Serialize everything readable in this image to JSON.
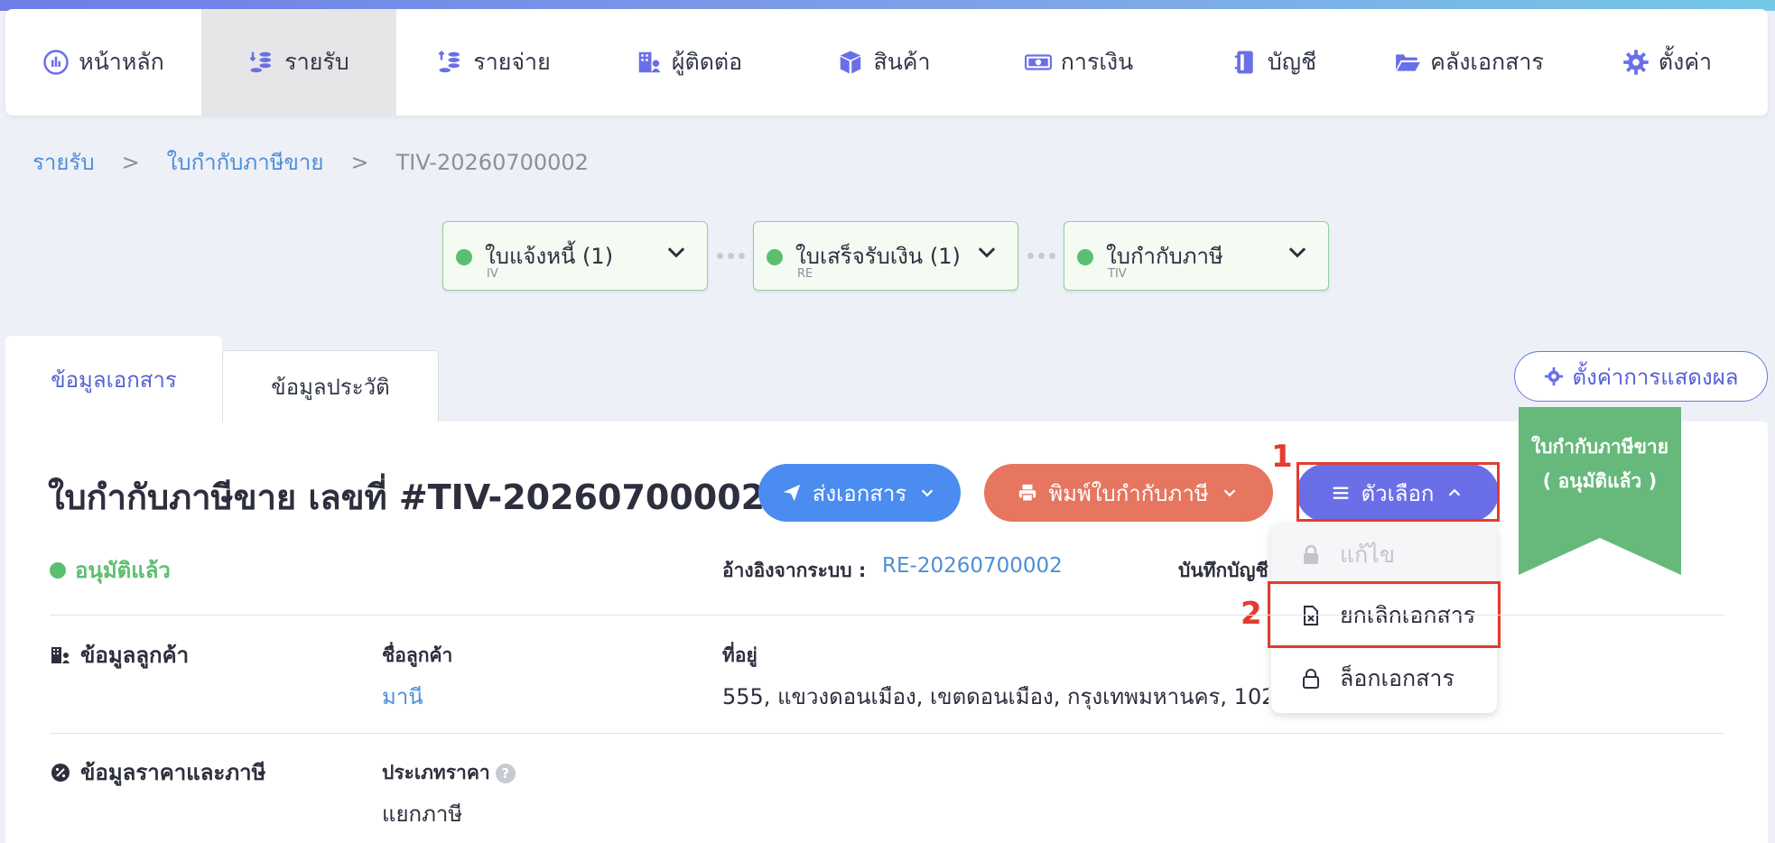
{
  "nav": {
    "items": [
      {
        "label": "หน้าหลัก",
        "icon": "dashboard-icon"
      },
      {
        "label": "รายรับ",
        "icon": "income-coins-icon"
      },
      {
        "label": "รายจ่าย",
        "icon": "expense-coins-icon"
      },
      {
        "label": "ผู้ติดต่อ",
        "icon": "contacts-building-icon"
      },
      {
        "label": "สินค้า",
        "icon": "box-icon"
      },
      {
        "label": "การเงิน",
        "icon": "money-icon"
      },
      {
        "label": "บัญชี",
        "icon": "ledger-icon"
      },
      {
        "label": "คลังเอกสาร",
        "icon": "folder-icon"
      },
      {
        "label": "ตั้งค่า",
        "icon": "gear-icon"
      }
    ],
    "active_index": 1
  },
  "breadcrumb": {
    "items": [
      "รายรับ",
      "ใบกำกับภาษีขาย",
      "TIV-20260700002"
    ],
    "separator": ">"
  },
  "flow": [
    {
      "title": "ใบแจ้งหนี้ (1)",
      "code": "IV"
    },
    {
      "title": "ใบเสร็จรับเงิน (1)",
      "code": "RE"
    },
    {
      "title": "ใบกำกับภาษี",
      "code": "TIV"
    }
  ],
  "tabs": {
    "info": "ข้อมูลเอกสาร",
    "history": "ข้อมูลประวัติ"
  },
  "display_settings": "ตั้งค่าการแสดงผล",
  "document": {
    "title": "ใบกำกับภาษีขาย เลขที่ #TIV-20260700002",
    "status": "อนุมัติแล้ว",
    "ref_label": "อ้างอิงจากระบบ :",
    "ref_value": "RE-20260700002",
    "journal_label": "บันทึกบัญชี"
  },
  "actions": {
    "send": "ส่งเอกสาร",
    "print": "พิมพ์ใบกำกับภาษี",
    "options": "ตัวเลือก"
  },
  "dropdown": {
    "edit": "แก้ไข",
    "cancel": "ยกเลิกเอกสาร",
    "lock": "ล็อกเอกสาร"
  },
  "annotations": {
    "step1": "1",
    "step2": "2"
  },
  "ribbon": {
    "line1": "ใบกำกับภาษีขาย",
    "line2": "( อนุมัติแล้ว )"
  },
  "customer": {
    "section": "ข้อมูลลูกค้า",
    "name_label": "ชื่อลูกค้า",
    "name_value": "มานี",
    "address_label": "ที่อยู่",
    "address_value": "555, แขวงดอนเมือง, เขตดอนเมือง, กรุงเทพมหานคร, 10210"
  },
  "pricing": {
    "section": "ข้อมูลราคาและภาษี",
    "type_label": "ประเภทราคา",
    "type_value": "แยกภาษี"
  },
  "colors": {
    "accent": "#6a6fe8",
    "send": "#4a8cf0",
    "print": "#e6765f",
    "approved": "#5cbf6f",
    "highlight": "#e23c2f"
  }
}
